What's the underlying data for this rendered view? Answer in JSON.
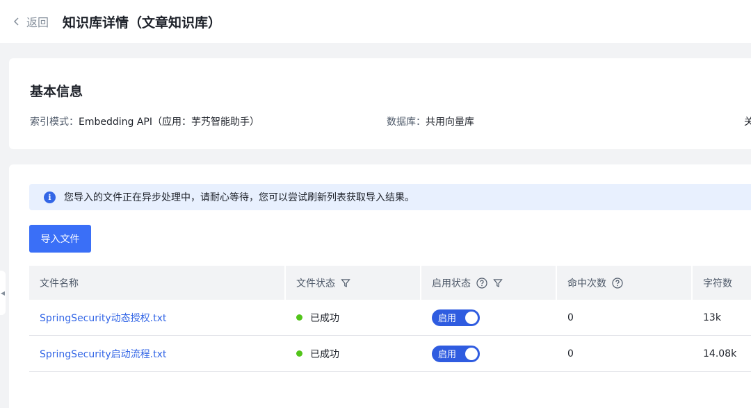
{
  "header": {
    "back_label": "返回",
    "title": "知识库详情（文章知识库）"
  },
  "basic_info": {
    "title": "基本信息",
    "index_mode_key": "索引模式：",
    "index_mode_value": "Embedding API（应用：芋艿智能助手）",
    "database_key": "数据库：",
    "database_value": "共用向量库",
    "truncated_key": "关"
  },
  "alert": {
    "text": "您导入的文件正在异步处理中，请耐心等待，您可以尝试刷新列表获取导入结果。"
  },
  "import_button_label": "导入文件",
  "table": {
    "columns": [
      "文件名称",
      "文件状态",
      "启用状态",
      "命中次数",
      "字符数"
    ],
    "rows": [
      {
        "name": "SpringSecurity动态授权.txt",
        "status": "已成功",
        "enabled_label": "启用",
        "enabled": true,
        "hits": "0",
        "chars": "13k"
      },
      {
        "name": "SpringSecurity启动流程.txt",
        "status": "已成功",
        "enabled_label": "启用",
        "enabled": true,
        "hits": "0",
        "chars": "14.08k"
      }
    ]
  },
  "colors": {
    "primary": "#3a6ff7",
    "link": "#3366e6",
    "success": "#52c41a",
    "alert_bg": "#e8f0fe"
  }
}
